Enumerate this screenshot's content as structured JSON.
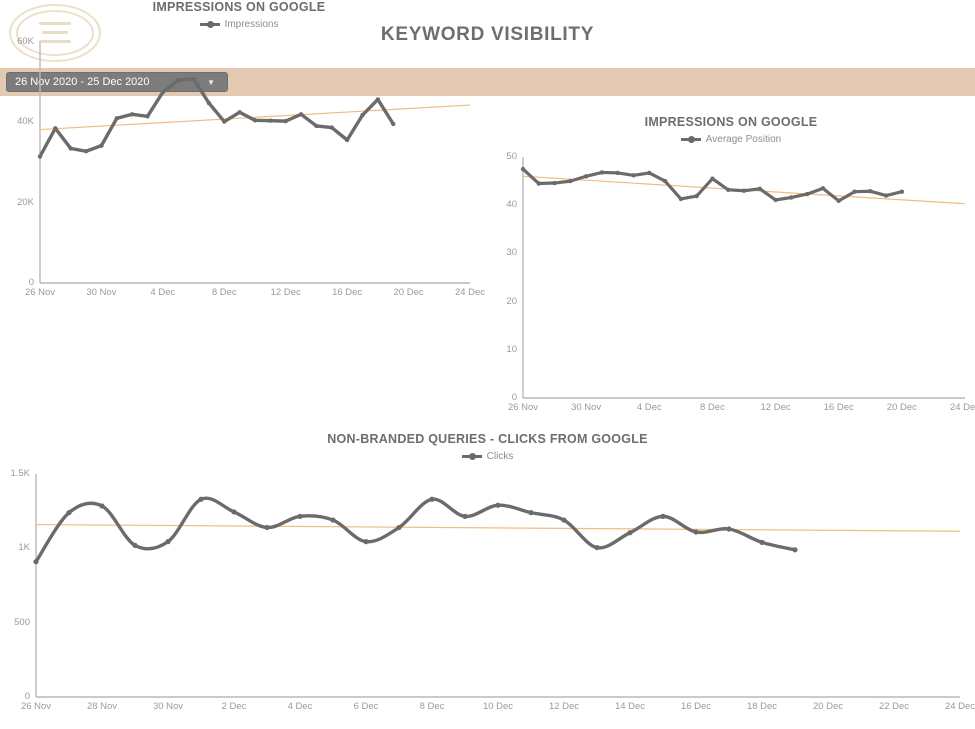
{
  "header": {
    "title": "KEYWORD VISIBILITY",
    "logo_icon": "oval-seal-logo",
    "band_color": "#e4c9b2",
    "title_color": "#6e6e6e"
  },
  "date_filter": {
    "value": "26 Nov 2020 - 25 Dec 2020",
    "caret_icon": "chevron-down-icon",
    "button_color": "#7c7c7c"
  },
  "style": {
    "line_color": "#6b6b6b",
    "trend_color": "#f0bd81",
    "axis_color": "#b9b9b9",
    "tick_color": "#9a9a9a"
  },
  "chart_data": [
    {
      "id": "impressions",
      "type": "line",
      "title": "IMPRESSIONS ON GOOGLE",
      "legend": [
        "Impressions"
      ],
      "legend_position": "top-center",
      "xlabel": "",
      "ylabel": "",
      "ylim": [
        0,
        60000
      ],
      "yticks": [
        0,
        20000,
        40000,
        60000
      ],
      "ytick_labels": [
        "0",
        "20K",
        "40K",
        "60K"
      ],
      "grid": false,
      "xtick_labels": [
        "26 Nov",
        "30 Nov",
        "4 Dec",
        "8 Dec",
        "12 Dec",
        "16 Dec",
        "20 Dec",
        "24 Dec"
      ],
      "x": [
        "26 Nov",
        "27 Nov",
        "28 Nov",
        "29 Nov",
        "30 Nov",
        "1 Dec",
        "2 Dec",
        "3 Dec",
        "4 Dec",
        "5 Dec",
        "6 Dec",
        "7 Dec",
        "8 Dec",
        "9 Dec",
        "10 Dec",
        "11 Dec",
        "12 Dec",
        "13 Dec",
        "14 Dec",
        "15 Dec",
        "16 Dec",
        "17 Dec",
        "18 Dec",
        "19 Dec"
      ],
      "values": [
        31500,
        38500,
        33500,
        32800,
        34200,
        41000,
        42000,
        41500,
        47500,
        50500,
        50800,
        44800,
        40200,
        42500,
        40500,
        40400,
        40300,
        42000,
        39100,
        38700,
        35600,
        41800,
        45700,
        39600
      ],
      "trend": {
        "type": "linear",
        "start": 38200,
        "end": 44300
      }
    },
    {
      "id": "average-position",
      "type": "line",
      "title": "IMPRESSIONS ON GOOGLE",
      "legend": [
        "Average Position"
      ],
      "legend_position": "top-center",
      "xlabel": "",
      "ylabel": "",
      "ylim": [
        0,
        50
      ],
      "yticks": [
        0,
        10,
        20,
        30,
        40,
        50
      ],
      "ytick_labels": [
        "0",
        "10",
        "20",
        "30",
        "40",
        "50"
      ],
      "grid": false,
      "xtick_labels": [
        "26 Nov",
        "30 Nov",
        "4 Dec",
        "8 Dec",
        "12 Dec",
        "16 Dec",
        "20 Dec",
        "24 Dec"
      ],
      "x": [
        "26 Nov",
        "27 Nov",
        "28 Nov",
        "29 Nov",
        "30 Nov",
        "1 Dec",
        "2 Dec",
        "3 Dec",
        "4 Dec",
        "5 Dec",
        "6 Dec",
        "7 Dec",
        "8 Dec",
        "9 Dec",
        "10 Dec",
        "11 Dec",
        "12 Dec",
        "13 Dec",
        "14 Dec",
        "15 Dec",
        "16 Dec",
        "17 Dec",
        "18 Dec",
        "19 Dec"
      ],
      "values": [
        47.5,
        44.5,
        44.6,
        45.0,
        46.0,
        46.8,
        46.7,
        46.2,
        46.7,
        45.0,
        41.3,
        41.9,
        45.5,
        43.2,
        43.0,
        43.4,
        41.1,
        41.6,
        42.3,
        43.5,
        40.9,
        42.8,
        42.9,
        42.0,
        42.8
      ],
      "trend": {
        "type": "linear",
        "start": 46.0,
        "end": 40.3
      }
    },
    {
      "id": "non-branded-clicks",
      "type": "line",
      "title": "NON-BRANDED QUERIES - CLICKS FROM GOOGLE",
      "legend": [
        "Clicks"
      ],
      "legend_position": "top-center",
      "xlabel": "",
      "ylabel": "",
      "ylim": [
        0,
        1500
      ],
      "yticks": [
        0,
        500,
        1000,
        1500
      ],
      "ytick_labels": [
        "0",
        "500",
        "1K",
        "1.5K"
      ],
      "grid": false,
      "xtick_labels": [
        "26 Nov",
        "28 Nov",
        "30 Nov",
        "2 Dec",
        "4 Dec",
        "6 Dec",
        "8 Dec",
        "10 Dec",
        "12 Dec",
        "14 Dec",
        "16 Dec",
        "18 Dec",
        "20 Dec",
        "22 Dec",
        "24 Dec"
      ],
      "x": [
        "26 Nov",
        "27 Nov",
        "28 Nov",
        "29 Nov",
        "30 Nov",
        "1 Dec",
        "2 Dec",
        "3 Dec",
        "4 Dec",
        "5 Dec",
        "6 Dec",
        "7 Dec",
        "8 Dec",
        "9 Dec",
        "10 Dec",
        "11 Dec",
        "12 Dec",
        "13 Dec",
        "14 Dec",
        "15 Dec",
        "16 Dec",
        "17 Dec",
        "18 Dec",
        "19 Dec"
      ],
      "values": [
        910,
        1240,
        1285,
        1020,
        1045,
        1330,
        1245,
        1140,
        1215,
        1190,
        1045,
        1140,
        1330,
        1215,
        1290,
        1240,
        1190,
        1005,
        1105,
        1215,
        1110,
        1130,
        1040,
        990
      ],
      "trend": {
        "type": "linear",
        "start": 1160,
        "end": 1115
      }
    }
  ]
}
